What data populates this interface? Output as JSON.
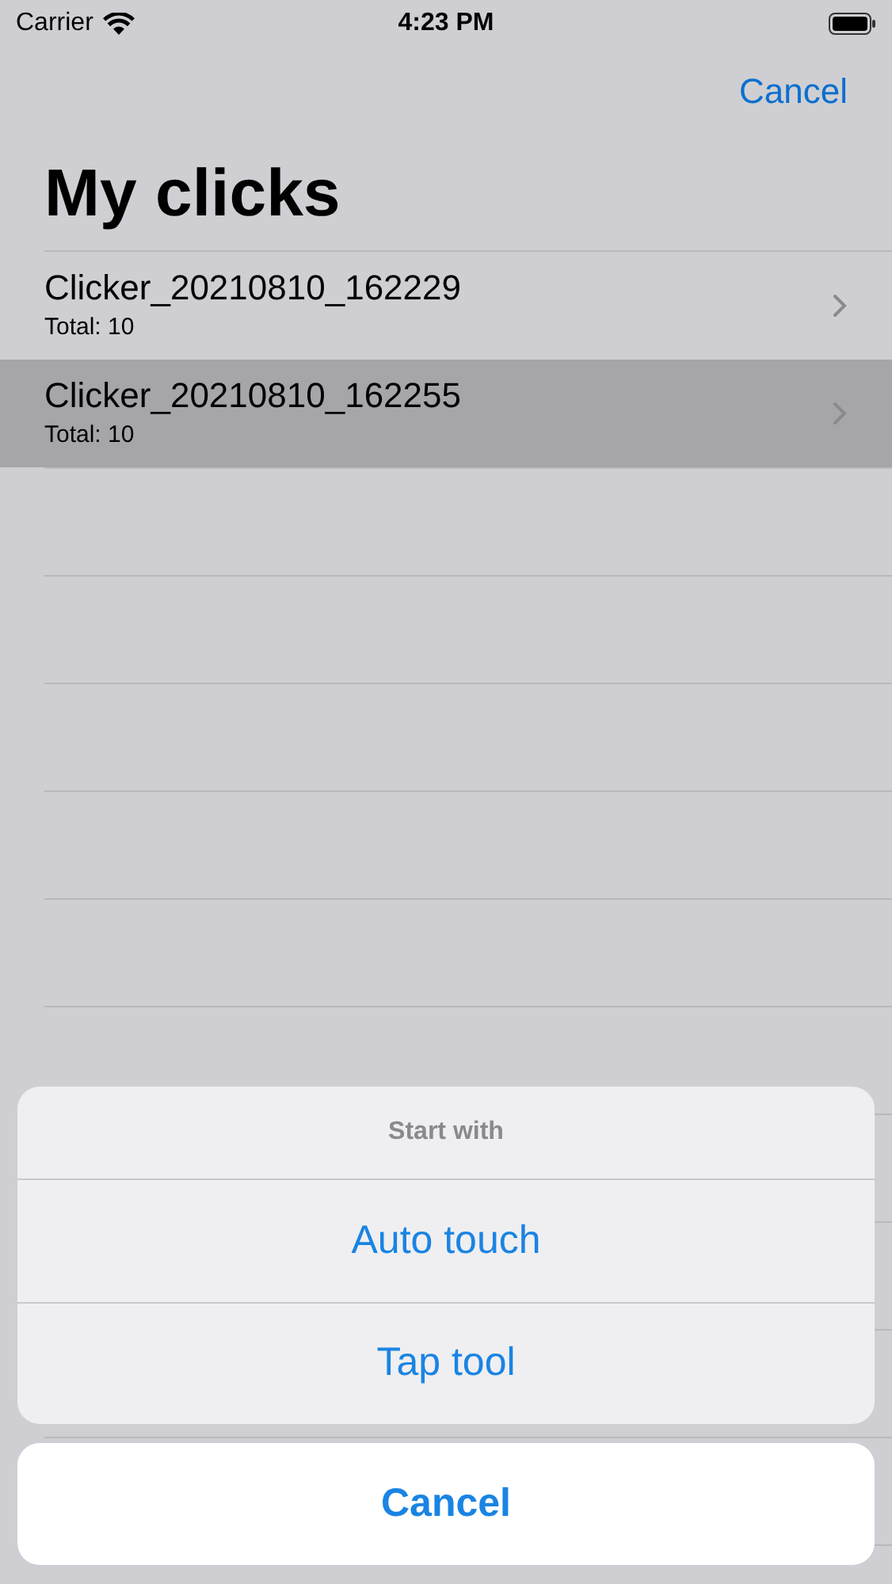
{
  "status_bar": {
    "carrier": "Carrier",
    "time": "4:23 PM"
  },
  "nav": {
    "cancel": "Cancel",
    "title": "My clicks"
  },
  "rows": [
    {
      "title": "Clicker_20210810_162229",
      "subtitle": "Total: 10",
      "selected": false
    },
    {
      "title": "Clicker_20210810_162255",
      "subtitle": "Total: 10",
      "selected": true
    }
  ],
  "action_sheet": {
    "title": "Start with",
    "actions": [
      "Auto touch",
      "Tap tool"
    ],
    "cancel": "Cancel"
  }
}
